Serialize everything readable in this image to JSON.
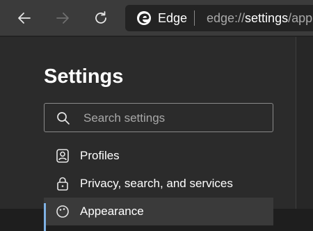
{
  "toolbar": {
    "back_icon": "back-arrow-icon",
    "forward_icon": "forward-arrow-icon",
    "refresh_icon": "refresh-icon"
  },
  "address_bar": {
    "site_name": "Edge",
    "url_scheme": "edge://",
    "url_host": "settings",
    "url_path": "/app"
  },
  "settings": {
    "title": "Settings",
    "search_placeholder": "Search settings"
  },
  "sidebar": {
    "items": [
      {
        "label": "Profiles",
        "icon": "profiles-icon"
      },
      {
        "label": "Privacy, search, and services",
        "icon": "lock-icon"
      },
      {
        "label": "Appearance",
        "icon": "appearance-icon"
      }
    ]
  },
  "colors": {
    "accent": "#7fb2e5",
    "toolbar_bg": "#3b3b3b",
    "sidebar_bg": "#2b2b2b"
  }
}
